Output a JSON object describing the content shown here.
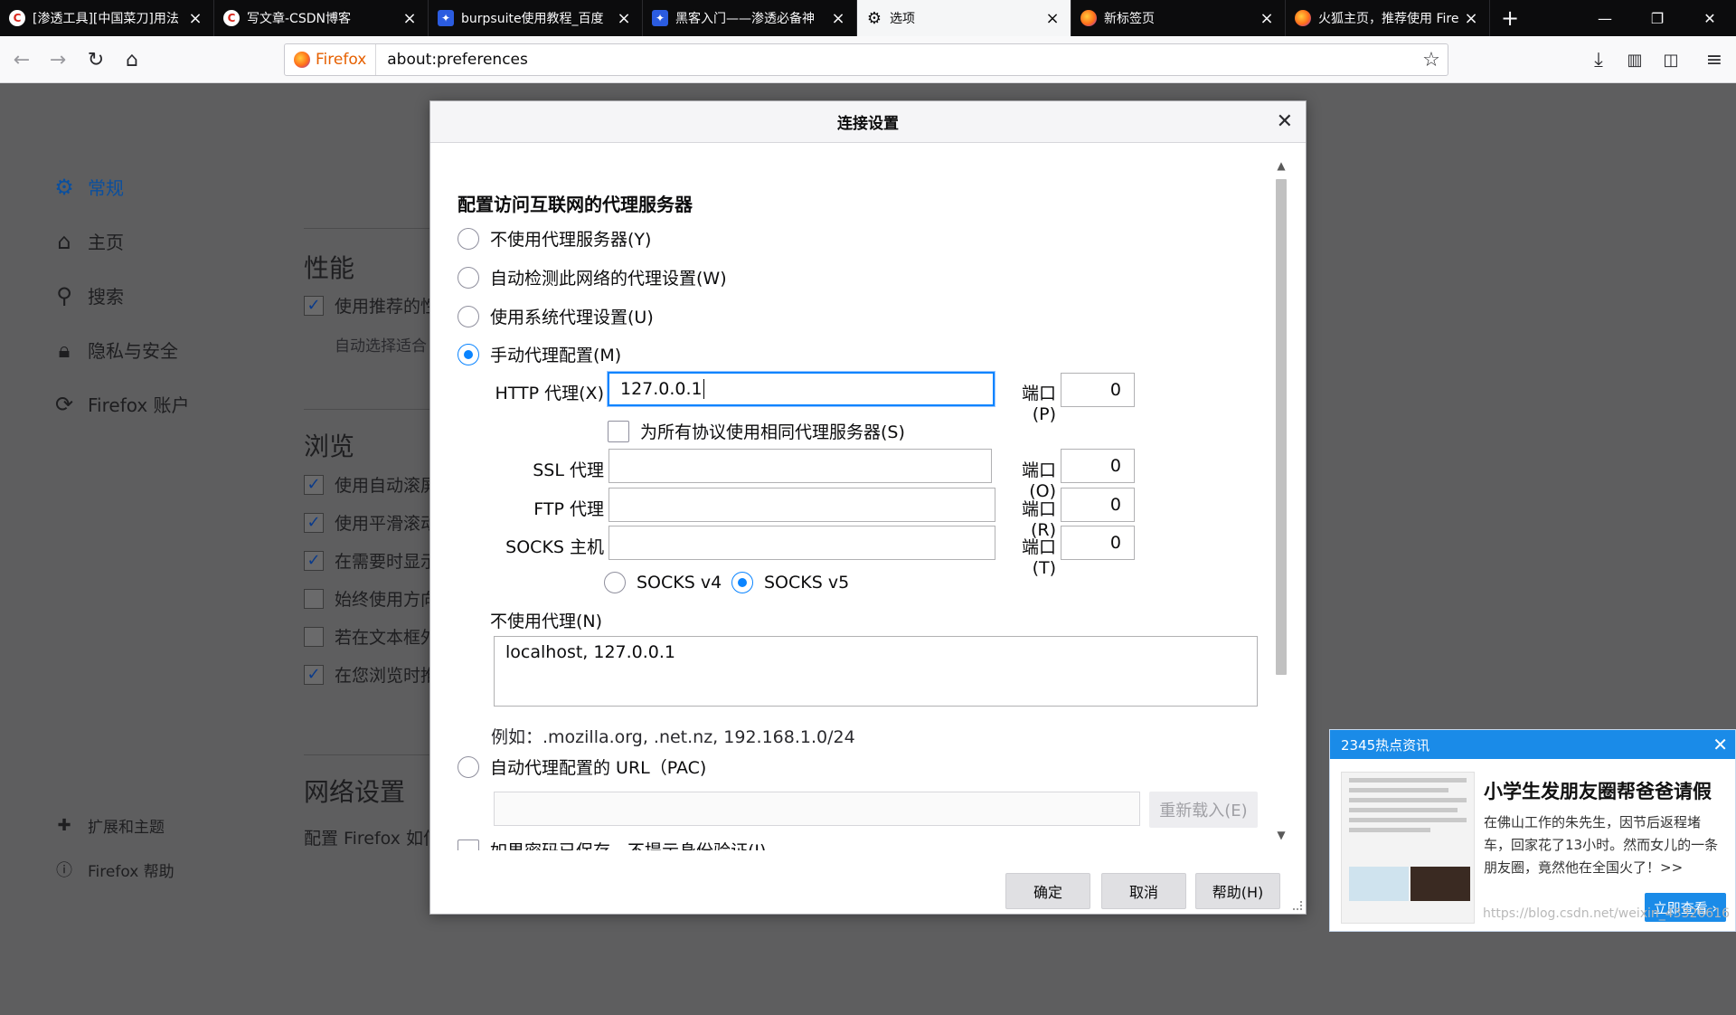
{
  "tabs": [
    {
      "label": "[渗透工具][中国菜刀]用法",
      "icon": "csdn-icon",
      "selected": false
    },
    {
      "label": "写文章-CSDN博客",
      "icon": "csdn-icon",
      "selected": false
    },
    {
      "label": "burpsuite使用教程_百度",
      "icon": "baidu-icon",
      "selected": false
    },
    {
      "label": "黑客入门——渗透必备神",
      "icon": "baidu-icon",
      "selected": false
    },
    {
      "label": "选项",
      "icon": "gear-icon",
      "selected": true
    },
    {
      "label": "新标签页",
      "icon": "firefox-icon",
      "selected": false
    },
    {
      "label": "火狐主页，推荐使用 Fire",
      "icon": "firefox-icon",
      "selected": false
    }
  ],
  "newtab_label": "+",
  "urlbar": {
    "identity": "Firefox",
    "url": "about:preferences"
  },
  "sidebar": {
    "categories": [
      {
        "label": "常规",
        "icon": "gear-icon"
      },
      {
        "label": "主页",
        "icon": "home-icon"
      },
      {
        "label": "搜索",
        "icon": "search-icon"
      },
      {
        "label": "隐私与安全",
        "icon": "lock-icon"
      },
      {
        "label": "Firefox 账户",
        "icon": "sync-icon"
      }
    ],
    "bottom": [
      {
        "label": "扩展和主题",
        "icon": "puzzle-icon"
      },
      {
        "label": "Firefox 帮助",
        "icon": "help-icon"
      }
    ]
  },
  "prefs": {
    "performance_title": "性能",
    "performance_row": "使用推荐的性",
    "performance_sub": "自动选择适合",
    "browsing_title": "浏览",
    "browsing_rows": [
      {
        "label": "使用自动滚屏",
        "checked": true
      },
      {
        "label": "使用平滑滚动",
        "checked": true
      },
      {
        "label": "在需要时显示",
        "checked": true
      },
      {
        "label": "始终使用方向",
        "checked": false
      },
      {
        "label": "若在文本框外",
        "checked": false
      },
      {
        "label": "在您浏览时推",
        "checked": true
      }
    ],
    "network_title": "网络设置",
    "network_row": "配置 Firefox 如何"
  },
  "dialog": {
    "title": "连接设置",
    "group_title": "配置访问互联网的代理服务器",
    "options": [
      {
        "label": "不使用代理服务器(Y)",
        "selected": false
      },
      {
        "label": "自动检测此网络的代理设置(W)",
        "selected": false
      },
      {
        "label": "使用系统代理设置(U)",
        "selected": false
      },
      {
        "label": "手动代理配置(M)",
        "selected": true
      }
    ],
    "http_label": "HTTP 代理(X)",
    "http_value": "127.0.0.1",
    "port_label_p": "端口(P)",
    "http_port": "0",
    "same_proxy_label": "为所有协议使用相同代理服务器(S)",
    "ssl_label": "SSL 代理",
    "port_label_o": "端口(O)",
    "ssl_port": "0",
    "ftp_label": "FTP 代理",
    "port_label_r": "端口(R)",
    "ftp_port": "0",
    "socks_label": "SOCKS 主机",
    "port_label_t": "端口(T)",
    "socks_port": "0",
    "socks_v4": "SOCKS v4",
    "socks_v5": "SOCKS v5",
    "no_proxy_label": "不使用代理(N)",
    "no_proxy_value": "localhost, 127.0.0.1",
    "example": "例如：.mozilla.org, .net.nz, 192.168.1.0/24",
    "pac_label": "自动代理配置的 URL（PAC)",
    "reload_label": "重新载入(E)",
    "cut_row": "如果密码已保存，不提示身份验证(I)",
    "ok": "确定",
    "cancel": "取消",
    "help": "帮助(H)"
  },
  "popup": {
    "header": "2345热点资讯",
    "title": "小学生发朋友圈帮爸爸请假",
    "text": "在佛山工作的朱先生，因节后返程堵车，回家花了13小时。然而女儿的一条朋友圈，竟然他在全国火了！>>",
    "button": "立即查看 ›"
  },
  "watermark": "https://blog.csdn.net/weixin_43326616",
  "colors": {
    "accent": "#0a84ff",
    "tabbar": "#0c0c0d",
    "popup_blue": "#1a8be8"
  }
}
